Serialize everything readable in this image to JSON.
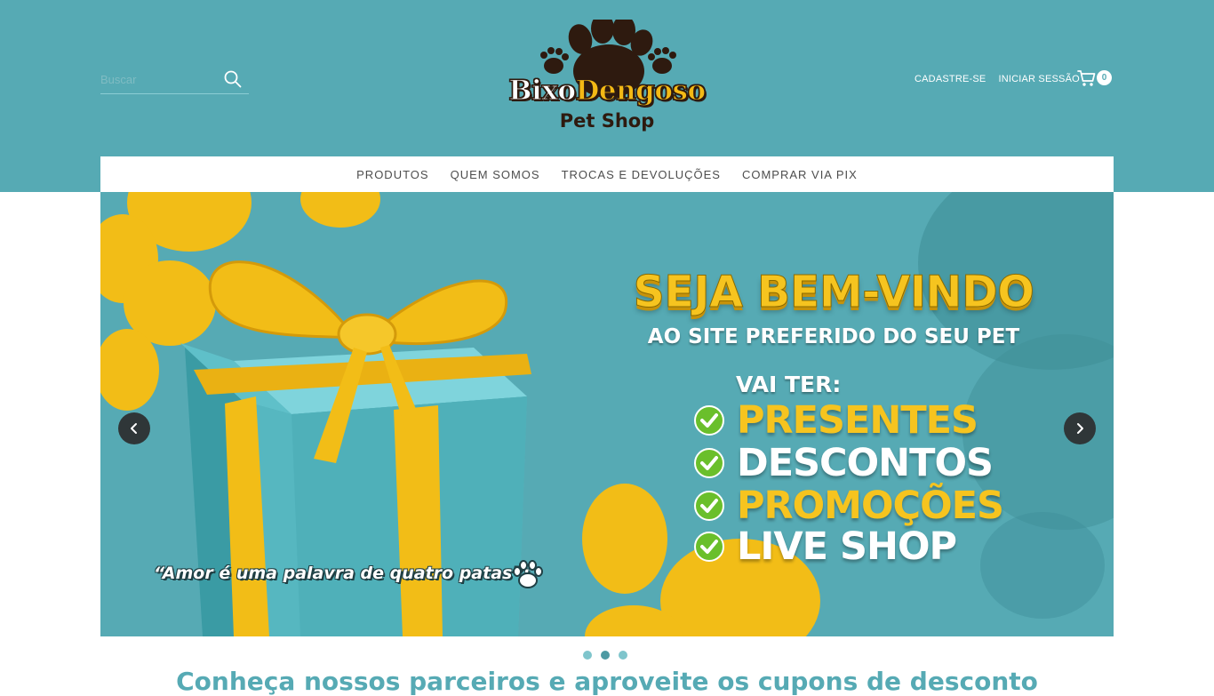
{
  "header": {
    "search_placeholder": "Buscar",
    "logo_brand_1": "Bixo",
    "logo_brand_2": "Dengoso",
    "logo_sub": "Pet Shop",
    "register_link": "CADASTRE-SE",
    "login_link": "INICIAR SESSÃO",
    "cart_count": "0"
  },
  "nav": {
    "items": [
      {
        "label": "PRODUTOS"
      },
      {
        "label": "QUEM SOMOS"
      },
      {
        "label": "TROCAS E DEVOLUÇÕES"
      },
      {
        "label": "COMPRAR VIA PIX"
      }
    ]
  },
  "banner": {
    "headline": "SEJA BEM-VINDO",
    "subheadline": "AO SITE PREFERIDO DO SEU PET",
    "intro": "VAI TER:",
    "benefits": [
      {
        "label": "PRESENTES",
        "color": "#f6c41f"
      },
      {
        "label": "DESCONTOS",
        "color": "#ffffff"
      },
      {
        "label": "PROMOÇÕES",
        "color": "#f6c41f"
      },
      {
        "label": "LIVE SHOP",
        "color": "#ffffff"
      }
    ],
    "quote": "“Amor é uma palavra de quatro patas”;"
  },
  "carousel": {
    "slide_count": 3,
    "active_index": 1
  },
  "section": {
    "title": "Conheça nossos parceiros e aproveite os cupons de desconto"
  },
  "colors": {
    "header_bg": "#56aab4",
    "accent_yellow": "#f6c41f",
    "brown": "#2e1a0f",
    "check_green": "#6abf2b"
  }
}
